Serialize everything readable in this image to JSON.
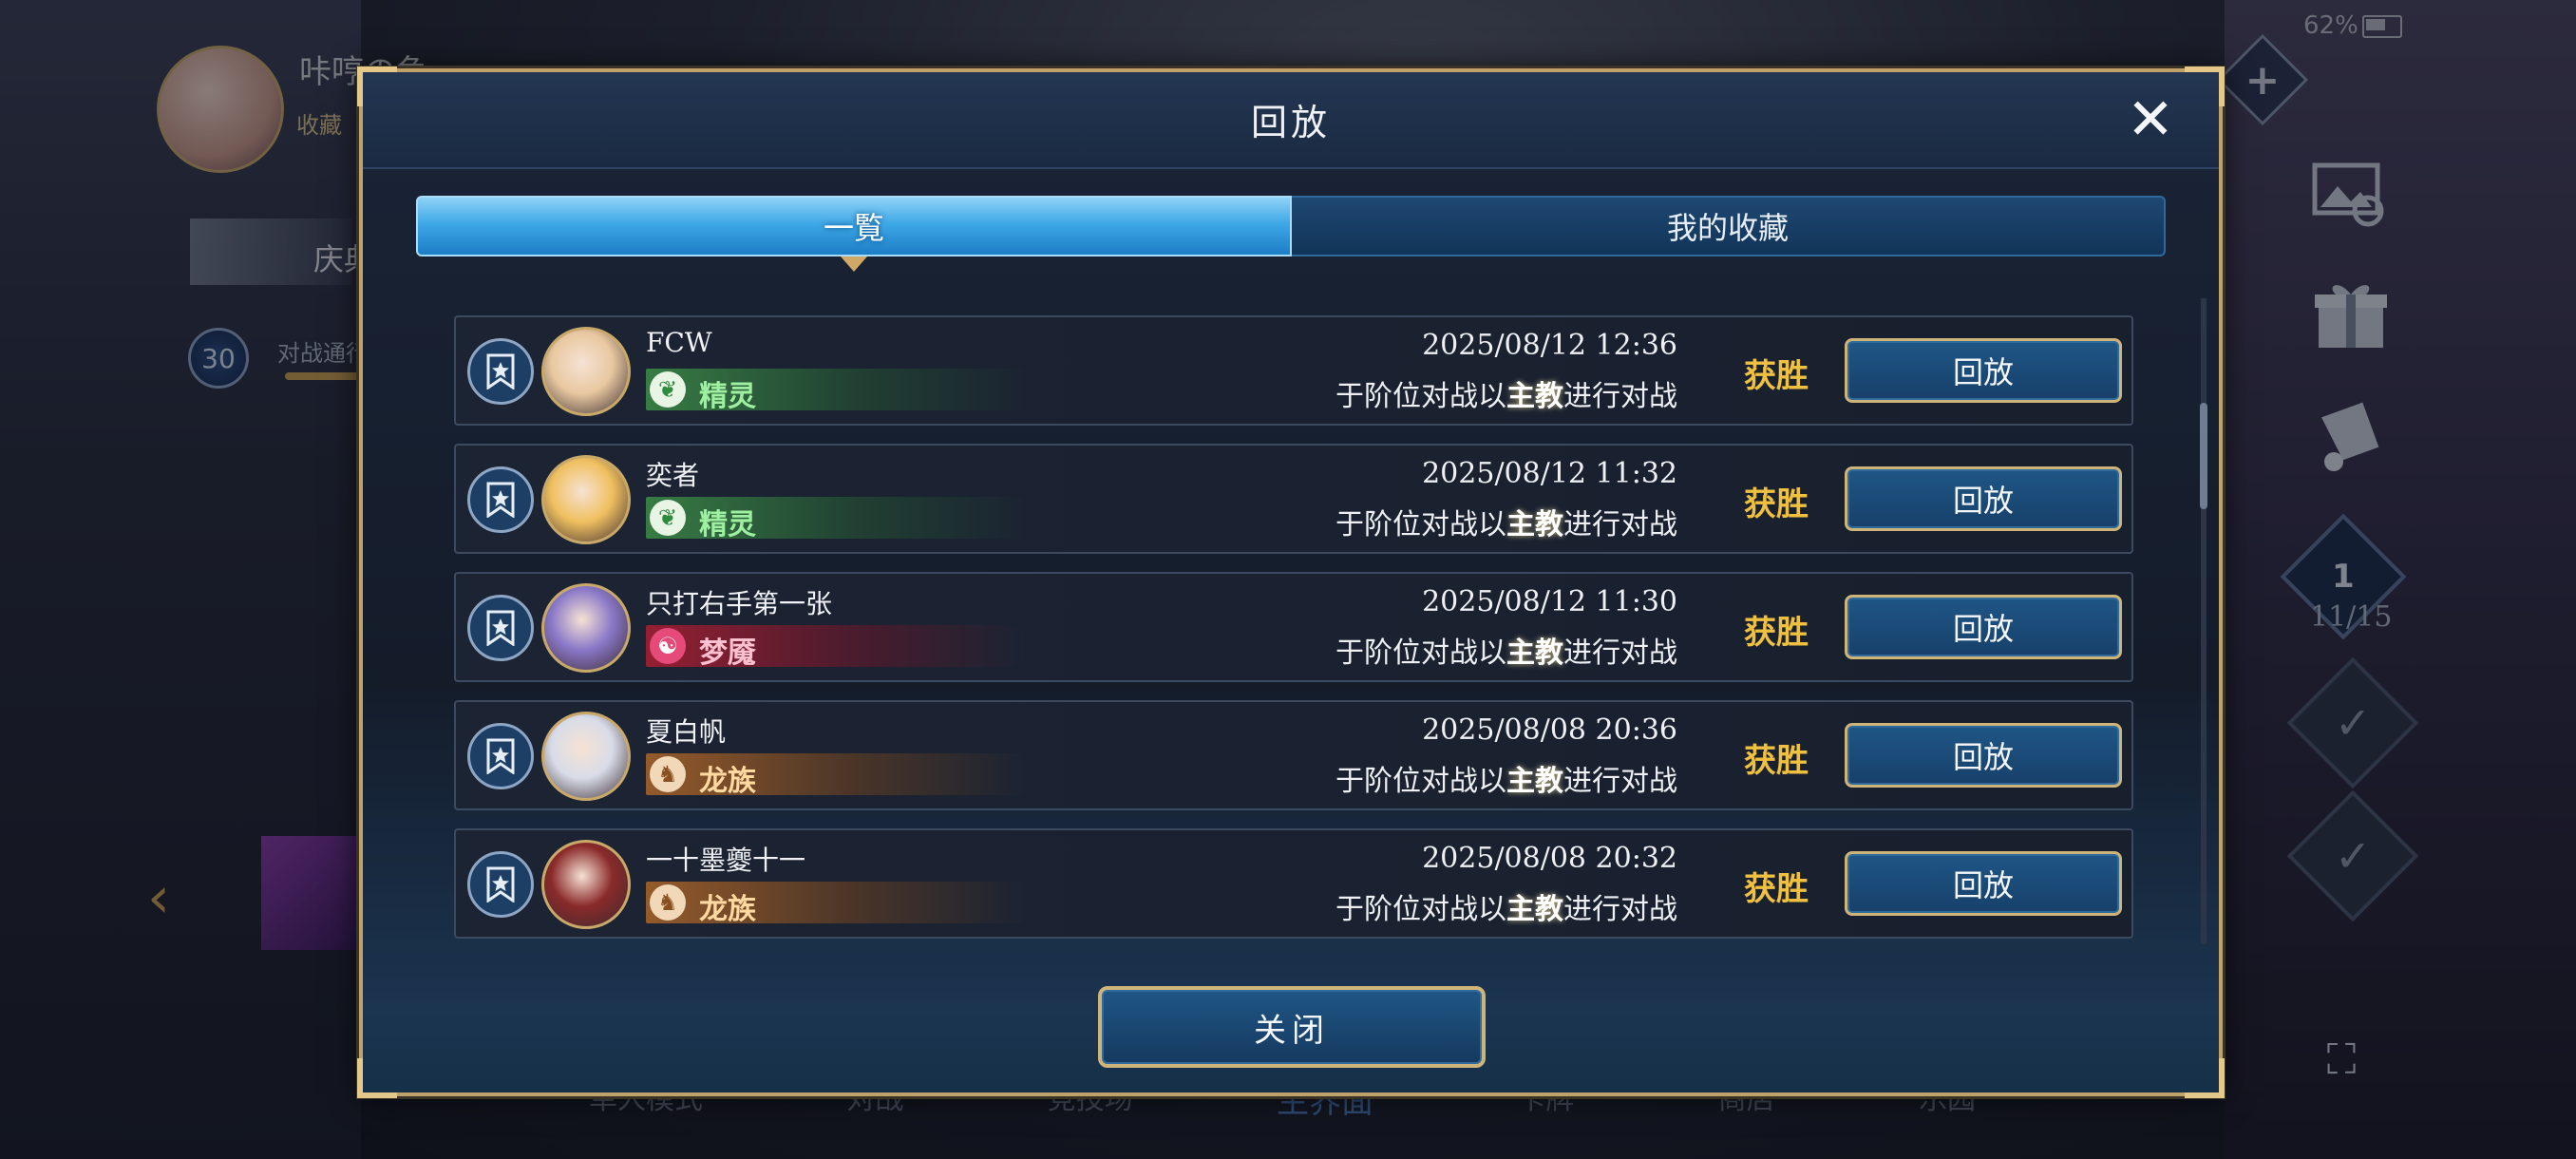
{
  "background": {
    "player_name": "咔哼の鱼",
    "collect_label": "收藏",
    "banner_text": "庆典",
    "pass_level": "30",
    "pass_label": "对战通行证",
    "battery_text": "62%",
    "mission_level": "1",
    "mission_count": "11/15",
    "bottom_nav": [
      "单人模式",
      "对战",
      "竞技场",
      "主界面",
      "卡牌",
      "商店",
      "乐园"
    ],
    "icons": [
      "plus-icon",
      "grid-menu-icon",
      "photo-icon",
      "gift-icon",
      "scroll-icon",
      "check-icon",
      "fullscreen-icon",
      "arrow-left-icon"
    ]
  },
  "dialog": {
    "title": "回放",
    "close_icon": "close-icon",
    "tabs": [
      {
        "label": "一覧",
        "active": true
      },
      {
        "label": "我的收藏",
        "active": false
      }
    ],
    "rows": [
      {
        "name": "FCW",
        "class": "精灵",
        "class_type": "elf",
        "class_icon": "leaf-icon",
        "date": "2025/08/12  12:36",
        "desc_pre": "于阶位对战以",
        "desc_key": "主教",
        "desc_post": "进行对战",
        "result": "获胜",
        "button": "回放",
        "portrait_color": "#e8c8a0"
      },
      {
        "name": "奕者",
        "class": "精灵",
        "class_type": "elf",
        "class_icon": "leaf-icon",
        "date": "2025/08/12  11:32",
        "desc_pre": "于阶位对战以",
        "desc_key": "主教",
        "desc_post": "进行对战",
        "result": "获胜",
        "button": "回放",
        "portrait_color": "#f0c060"
      },
      {
        "name": "只打右手第一张",
        "class": "梦魇",
        "class_type": "demon",
        "class_icon": "demon-icon",
        "date": "2025/08/12  11:30",
        "desc_pre": "于阶位对战以",
        "desc_key": "主教",
        "desc_post": "进行对战",
        "result": "获胜",
        "button": "回放",
        "portrait_color": "#8a78c8"
      },
      {
        "name": "夏白帆",
        "class": "龙族",
        "class_type": "dragon",
        "class_icon": "dragon-icon",
        "date": "2025/08/08  20:36",
        "desc_pre": "于阶位对战以",
        "desc_key": "主教",
        "desc_post": "进行对战",
        "result": "获胜",
        "button": "回放",
        "portrait_color": "#d8dce8"
      },
      {
        "name": "一十墨夔十一",
        "class": "龙族",
        "class_type": "dragon",
        "class_icon": "dragon-icon",
        "date": "2025/08/08  20:32",
        "desc_pre": "于阶位对战以",
        "desc_key": "主教",
        "desc_post": "进行对战",
        "result": "获胜",
        "button": "回放",
        "portrait_color": "#8a2a2a"
      }
    ],
    "bottom_close_label": "关闭"
  }
}
